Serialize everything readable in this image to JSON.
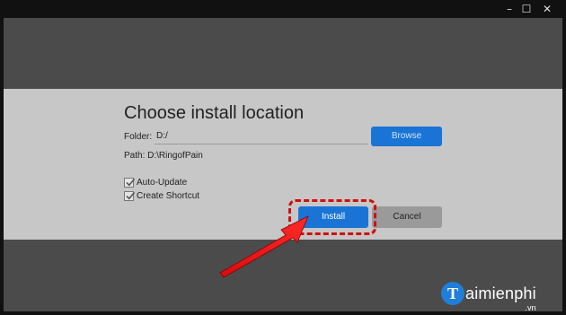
{
  "window": {
    "minimize_glyph": "–",
    "maximize_glyph": "☐",
    "close_glyph": "✕"
  },
  "dialog": {
    "title": "Choose install location",
    "folder_label": "Folder:",
    "folder_value": "D:/",
    "browse_label": "Browse",
    "path_text": "Path: D:\\RingofPain",
    "checkboxes": [
      {
        "label": "Auto-Update",
        "checked": true
      },
      {
        "label": "Create Shortcut",
        "checked": true
      }
    ],
    "install_label": "Install",
    "cancel_label": "Cancel"
  },
  "watermark": {
    "logo_letter": "T",
    "brand": "aimienphi",
    "tld": ".vn"
  },
  "colors": {
    "accent": "#1a74d6",
    "highlight": "#d10f0f",
    "panel": "#c7c7c7"
  }
}
